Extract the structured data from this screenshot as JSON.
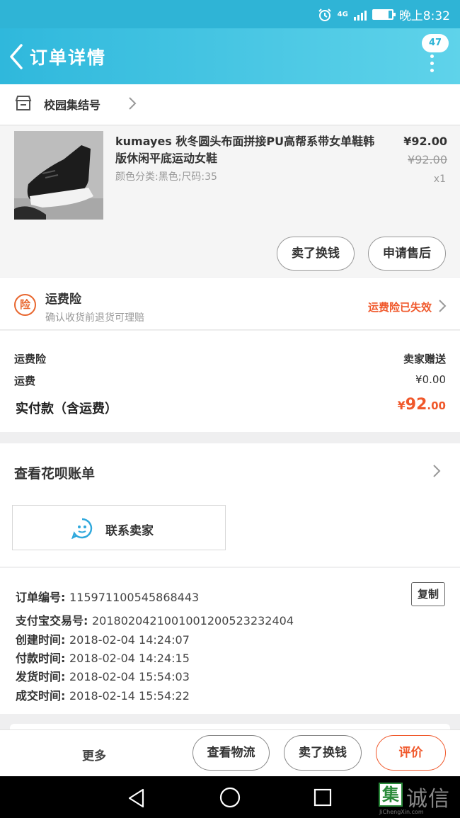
{
  "status_bar": {
    "network": "4G",
    "time": "晚上8:32",
    "battery_level": 0.8
  },
  "header": {
    "title": "订单详情",
    "message_count": "47"
  },
  "store": {
    "name": "校园集结号"
  },
  "product": {
    "title": "kumayes 秋冬圆头布面拼接PU高帮系带女单鞋韩版休闲平底运动女鞋",
    "sku": "颜色分类:黑色;尺码:35",
    "price": "¥92.00",
    "original_price": "¥92.00",
    "quantity": "x1",
    "buttons": {
      "refund_label": "卖了换钱",
      "after_sale_label": "申请售后"
    }
  },
  "insurance": {
    "title": "运费险",
    "subtitle": "确认收货前退货可理赔",
    "status": "运费险已失效",
    "icon_char": "险"
  },
  "fees": {
    "insurance_label": "运费险",
    "insurance_value": "卖家赠送",
    "shipping_label": "运费",
    "shipping_value": "¥0.00",
    "total_label": "实付款（含运费）",
    "total_currency": "¥",
    "total_int": "92",
    "total_dec": ".00"
  },
  "huabei": {
    "label": "查看花呗账单",
    "contact_label": "联系卖家"
  },
  "order_info": {
    "copy_label": "复制",
    "lines": [
      {
        "key": "订单编号: ",
        "value": "115971100545868443"
      },
      {
        "key": "支付宝交易号: ",
        "value": "2018020421001001200523232404"
      },
      {
        "key": "创建时间: ",
        "value": "2018-02-04 14:24:07"
      },
      {
        "key": "付款时间: ",
        "value": "2018-02-04 14:24:15"
      },
      {
        "key": "发货时间: ",
        "value": "2018-02-04 15:54:03"
      },
      {
        "key": "成交时间: ",
        "value": "2018-02-14 15:54:22"
      }
    ]
  },
  "action_bar": {
    "more_label": "更多",
    "logistics_label": "查看物流",
    "resell_label": "卖了换钱",
    "rate_label": "评价"
  },
  "watermark": {
    "box_char": "集",
    "text": "诚信",
    "url": "JiChengXin.com"
  },
  "colors": {
    "brand": "#2fb4d6",
    "accent": "#f0582b"
  }
}
